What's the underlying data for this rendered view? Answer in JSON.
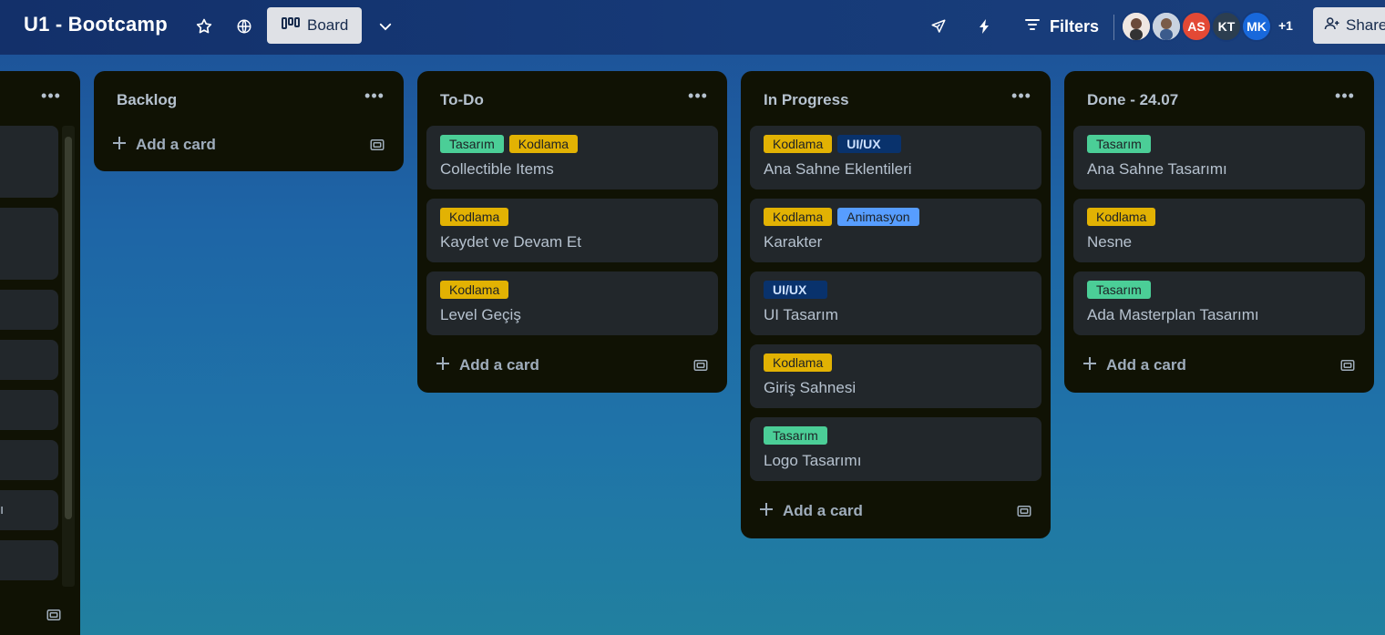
{
  "header": {
    "board_title": "U1 - Bootcamp",
    "view_label": "Board",
    "filters_label": "Filters",
    "share_label": "Share",
    "members": [
      {
        "initials": "",
        "color": "#e8d6cc"
      },
      {
        "initials": "",
        "color": "#c9d3e0"
      },
      {
        "initials": "AS",
        "color": "#e34935"
      },
      {
        "initials": "KT",
        "color": "#2c3e50"
      },
      {
        "initials": "MK",
        "color": "#1868db"
      }
    ],
    "more_members": "+1"
  },
  "partial_list": {
    "fragment_text": "ı"
  },
  "lists": [
    {
      "title": "Backlog",
      "cards": [],
      "add_card_label": "Add a card"
    },
    {
      "title": "To-Do",
      "cards": [
        {
          "labels": [
            {
              "text": "Tasarım",
              "type": "tasarim"
            },
            {
              "text": "Kodlama",
              "type": "kodlama"
            }
          ],
          "title": "Collectible Items"
        },
        {
          "labels": [
            {
              "text": "Kodlama",
              "type": "kodlama"
            }
          ],
          "title": "Kaydet ve Devam Et"
        },
        {
          "labels": [
            {
              "text": "Kodlama",
              "type": "kodlama"
            }
          ],
          "title": "Level Geçiş"
        }
      ],
      "add_card_label": "Add a card"
    },
    {
      "title": "In Progress",
      "cards": [
        {
          "labels": [
            {
              "text": "Kodlama",
              "type": "kodlama"
            },
            {
              "text": "UI/UX",
              "type": "uiux"
            }
          ],
          "title": "Ana Sahne Eklentileri"
        },
        {
          "labels": [
            {
              "text": "Kodlama",
              "type": "kodlama"
            },
            {
              "text": "Animasyon",
              "type": "animasyon"
            }
          ],
          "title": "Karakter"
        },
        {
          "labels": [
            {
              "text": "UI/UX",
              "type": "uiux"
            }
          ],
          "title": "UI Tasarım"
        },
        {
          "labels": [
            {
              "text": "Kodlama",
              "type": "kodlama"
            }
          ],
          "title": "Giriş Sahnesi"
        },
        {
          "labels": [
            {
              "text": "Tasarım",
              "type": "tasarim"
            }
          ],
          "title": "Logo Tasarımı"
        }
      ],
      "add_card_label": "Add a card"
    },
    {
      "title": "Done - 24.07",
      "cards": [
        {
          "labels": [
            {
              "text": "Tasarım",
              "type": "tasarim"
            }
          ],
          "title": "Ana Sahne Tasarımı"
        },
        {
          "labels": [
            {
              "text": "Kodlama",
              "type": "kodlama"
            }
          ],
          "title": "Nesne"
        },
        {
          "labels": [
            {
              "text": "Tasarım",
              "type": "tasarim"
            }
          ],
          "title": "Ada Masterplan Tasarımı"
        }
      ],
      "add_card_label": "Add a card"
    }
  ],
  "colors": {
    "list_bg": "#101204",
    "card_bg": "#22272b",
    "label_tasarim": "#4bce97",
    "label_kodlama": "#e2b203",
    "label_uiux": "#09326c",
    "label_animasyon": "#579dff"
  },
  "icons": {
    "star": "star-icon",
    "visibility": "globe-icon",
    "view": "board-icon",
    "chevron": "chevron-down-icon",
    "power_ups": "rocket-icon",
    "automation": "lightning-icon",
    "filter": "filter-icon",
    "share": "add-person-icon",
    "list_menu": "ellipsis-icon",
    "add": "plus-icon",
    "template": "template-icon"
  }
}
